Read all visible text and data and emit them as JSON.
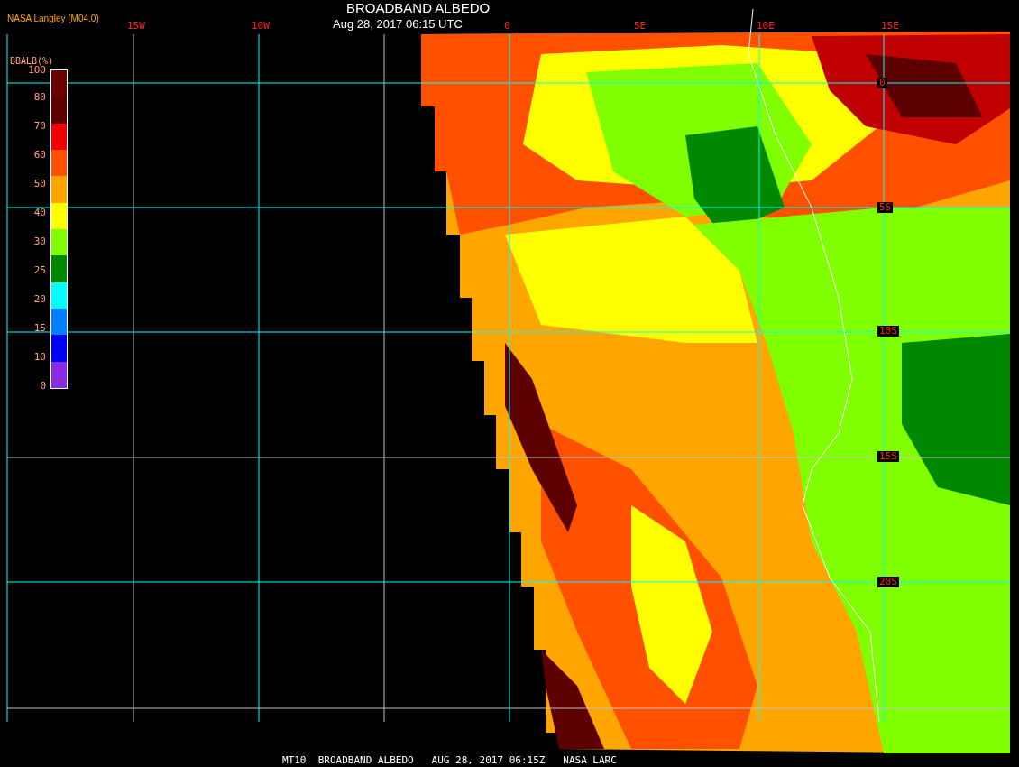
{
  "title": "BROADBAND ALBEDO",
  "subtitle": "Aug 28, 2017 06:15 UTC",
  "credit": "NASA Langley (M04.0)",
  "legend": {
    "title": "BBALB(%)",
    "labels": [
      "100",
      "80",
      "70",
      "60",
      "50",
      "40",
      "30",
      "25",
      "20",
      "15",
      "10",
      "0"
    ],
    "segments": [
      {
        "color": "#6a0000"
      },
      {
        "color": "#5c0000"
      },
      {
        "color": "#f00000"
      },
      {
        "color": "#ff5000"
      },
      {
        "color": "#ffa500"
      },
      {
        "color": "#ffff00"
      },
      {
        "color": "#80ff00"
      },
      {
        "color": "#008800"
      },
      {
        "color": "#00ffff"
      },
      {
        "color": "#0080ff"
      },
      {
        "color": "#0000ff"
      },
      {
        "color": "#8a2be2"
      }
    ]
  },
  "longitude_labels": [
    "15W",
    "10W",
    "0",
    "5E",
    "10E",
    "15E"
  ],
  "latitude_labels": [
    "0",
    "5S",
    "10S",
    "15S",
    "20S"
  ],
  "footer": "MT10  BROADBAND ALBEDO   AUG 28, 2017 06:15Z   NASA LARC"
}
